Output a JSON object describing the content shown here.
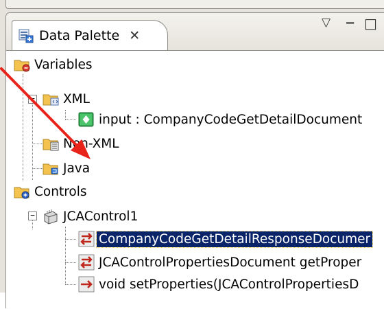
{
  "panel": {
    "title": "Data Palette",
    "close_glyph": "✕",
    "menu_glyph": "▽",
    "minimize_glyph": "−",
    "maximize_glyph": "□"
  },
  "tree": {
    "variables": {
      "label": "Variables",
      "xml": {
        "label": "XML",
        "input": "input : CompanyCodeGetDetailDocument"
      },
      "non_xml": "Non-XML",
      "java": "Java"
    },
    "controls": {
      "label": "Controls",
      "jca": {
        "label": "JCAControl1",
        "methods": [
          "CompanyCodeGetDetailResponseDocumer",
          "JCAControlPropertiesDocument getProper",
          "void setProperties(JCAControlPropertiesD"
        ]
      }
    },
    "expand_minus": "−"
  },
  "colors": {
    "selection": "#0a246a",
    "arrow": "#e8231a",
    "folder": "#f4c24f"
  }
}
